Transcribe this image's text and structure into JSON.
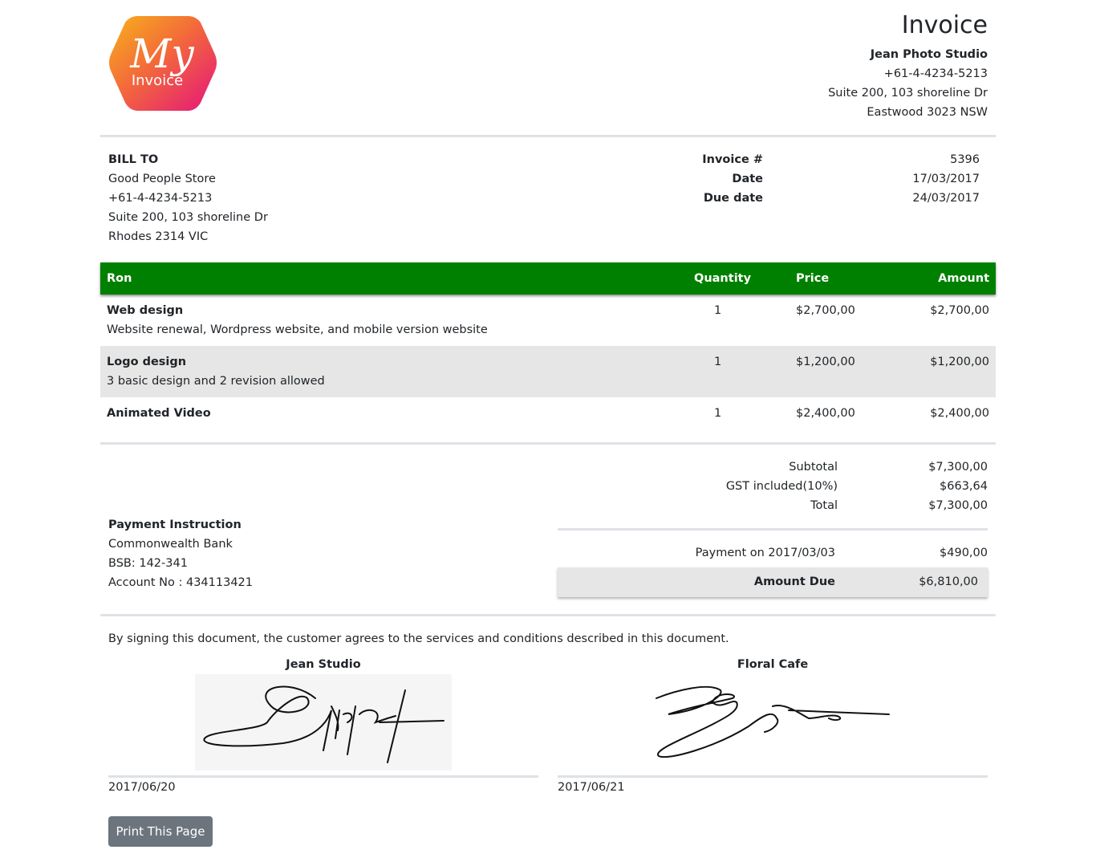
{
  "logo": {
    "script_text": "My",
    "label": "Invoice"
  },
  "header": {
    "title": "Invoice",
    "company": "Jean Photo Studio",
    "phone": "+61-4-4234-5213",
    "address1": "Suite 200, 103 shoreline Dr",
    "address2": "Eastwood 3023 NSW"
  },
  "bill_to": {
    "heading": "BILL TO",
    "name": "Good People Store",
    "phone": "+61-4-4234-5213",
    "address1": "Suite 200, 103 shoreline Dr",
    "address2": "Rhodes 2314 VIC"
  },
  "meta": {
    "invoice_label": "Invoice #",
    "invoice_value": "5396",
    "date_label": "Date",
    "date_value": "17/03/2017",
    "due_label": "Due date",
    "due_value": "24/03/2017"
  },
  "table": {
    "headers": [
      "Ron",
      "Quantity",
      "Price",
      "Amount"
    ],
    "rows": [
      {
        "name": "Web design",
        "description": "Website renewal, Wordpress website, and mobile version website",
        "qty": "1",
        "price": "$2,700,00",
        "amount": "$2,700,00"
      },
      {
        "name": "Logo design",
        "description": "3 basic design and 2 revision allowed",
        "qty": "1",
        "price": "$1,200,00",
        "amount": "$1,200,00"
      },
      {
        "name": "Animated Video",
        "description": "",
        "qty": "1",
        "price": "$2,400,00",
        "amount": "$2,400,00"
      }
    ]
  },
  "totals": {
    "subtotal_label": "Subtotal",
    "subtotal_value": "$7,300,00",
    "gst_label": "GST included(10%)",
    "gst_value": "$663,64",
    "total_label": "Total",
    "total_value": "$7,300,00",
    "payment_label": "Payment on 2017/03/03",
    "payment_value": "$490,00",
    "due_label": "Amount Due",
    "due_value": "$6,810,00"
  },
  "payment": {
    "heading": "Payment Instruction",
    "bank": "Commonwealth Bank",
    "bsb": "BSB: 142-341",
    "account": "Account No : 434113421"
  },
  "agreement": "By signing this document, the customer agrees to the services and conditions described in this document.",
  "signatures": [
    {
      "name": "Jean Studio",
      "date": "2017/06/20"
    },
    {
      "name": "Floral Cafe",
      "date": "2017/06/21"
    }
  ],
  "actions": {
    "print_label": "Print This Page"
  },
  "colors": {
    "table_header": "#008000",
    "button": "#6c757d",
    "alt_row": "#e6e6e6"
  }
}
